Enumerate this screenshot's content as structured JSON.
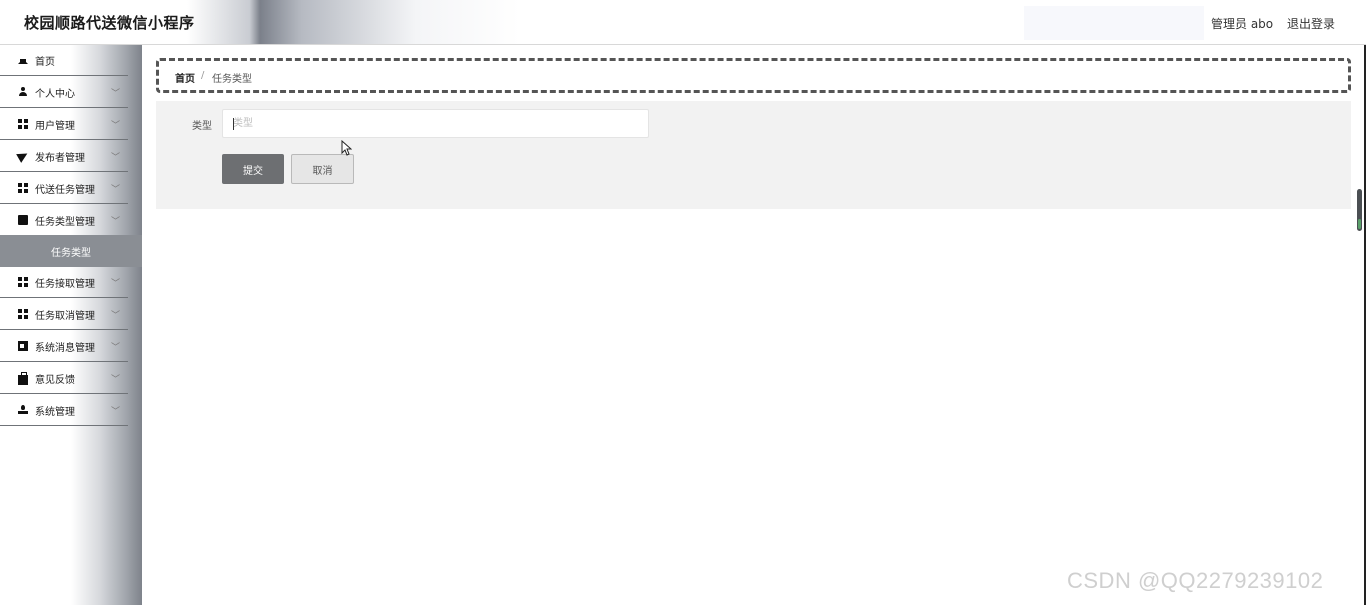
{
  "header": {
    "title": "校园顺路代送微信小程序",
    "user_label": "管理员 abo",
    "logout_label": "退出登录"
  },
  "sidebar": {
    "items": [
      {
        "label": "首页",
        "icon": "home-icon"
      },
      {
        "label": "个人中心",
        "icon": "user-icon"
      },
      {
        "label": "用户管理",
        "icon": "grid-icon"
      },
      {
        "label": "发布者管理",
        "icon": "send-icon"
      },
      {
        "label": "代送任务管理",
        "icon": "grid-icon"
      },
      {
        "label": "任务类型管理",
        "icon": "chat-icon"
      },
      {
        "label": "任务接取管理",
        "icon": "grid-icon"
      },
      {
        "label": "任务取消管理",
        "icon": "grid-icon"
      },
      {
        "label": "系统消息管理",
        "icon": "trash-icon"
      },
      {
        "label": "意见反馈",
        "icon": "briefcase-icon"
      },
      {
        "label": "系统管理",
        "icon": "admin-icon"
      }
    ],
    "active_subitem": "任务类型"
  },
  "breadcrumb": {
    "home": "首页",
    "separator": "/",
    "current": "任务类型"
  },
  "form": {
    "type_label": "类型",
    "type_placeholder": "类型",
    "type_value": "",
    "submit_label": "提交",
    "cancel_label": "取消"
  },
  "watermark": "CSDN @QQ2279239102",
  "colors": {
    "submit_bg": "#6d6f72",
    "active_submenu_bg": "#8a8e94",
    "panel_bg": "#f2f2f2"
  }
}
